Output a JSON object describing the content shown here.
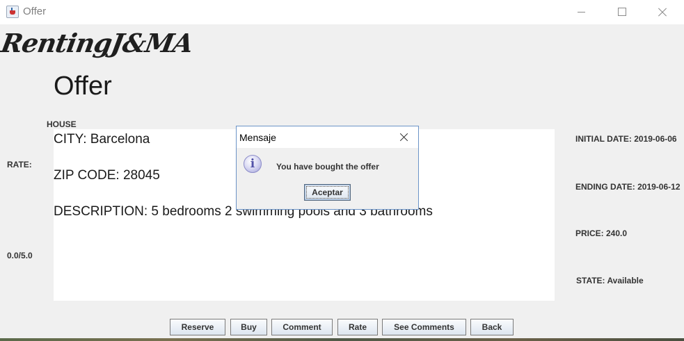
{
  "window": {
    "title": "Offer",
    "minimize_icon": "minimize-icon",
    "maximize_icon": "maximize-icon",
    "close_icon": "close-icon"
  },
  "app": {
    "logo_text": "RentingJ&MA",
    "page_title": "Offer"
  },
  "offer": {
    "type_label": "HOUSE",
    "city": "CITY: Barcelona",
    "zip": "ZIP CODE: 28045",
    "description": "DESCRIPTION: 5 bedrooms 2 swimming pools and 3 bathrooms"
  },
  "rating": {
    "label": "RATE:",
    "value": "0.0/5.0"
  },
  "details": {
    "initial_date": "INITIAL DATE: 2019-06-06",
    "ending_date": "ENDING DATE: 2019-06-12",
    "price": "PRICE: 240.0",
    "state": "STATE: Available"
  },
  "actions": {
    "reserve": "Reserve",
    "buy": "Buy",
    "comment": "Comment",
    "rate": "Rate",
    "see_comments": "See Comments",
    "back": "Back"
  },
  "dialog": {
    "title": "Mensaje",
    "message": "You have bought the offer",
    "accept_label": "Aceptar",
    "icon": "info-icon",
    "icon_glyph": "i"
  },
  "colors": {
    "window_bg": "#f0f0f0",
    "panel_bg": "#ffffff",
    "dialog_border": "#6b93c7",
    "button_border": "#7a7a7a"
  }
}
